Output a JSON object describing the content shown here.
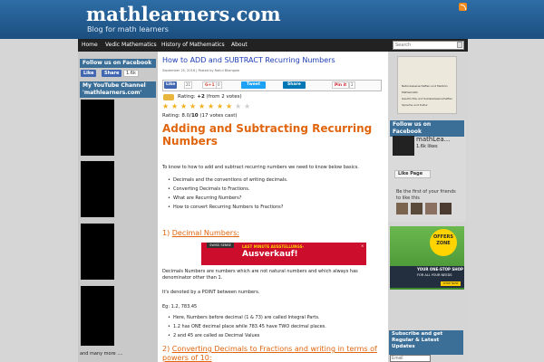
{
  "site": {
    "title": "mathlearners.com",
    "tagline": "Blog for math learners",
    "rss_icon": "rss-icon"
  },
  "nav": {
    "items": [
      "Home",
      "Vedic Mathematics",
      "History of Mathematics",
      "About"
    ],
    "search_placeholder": "Search"
  },
  "left_sidebar": {
    "follow_title": "Follow us on Facebook",
    "like_label": "Like",
    "share_label": "Share",
    "like_count": "1.6k",
    "youtube_title": "My YouTube Channel 'mathlearners.com'",
    "more_label": "and many more ...."
  },
  "post": {
    "title": "How to ADD and SUBTRACT Recurring Numbers",
    "meta": "September 25, 2016 | Posted by Rahul Bhangale",
    "share": {
      "like": "Like",
      "like_count": "21",
      "gplus": "G+1",
      "gplus_count": "0",
      "tweet": "Tweet",
      "linkedin": "Share",
      "pin": "Pin it",
      "pin_count": "2"
    },
    "rating_line": "Rating: +2 (from 2 votes)",
    "rating_prefix": "Rating: ",
    "rating_value": "+2",
    "rating_votes": " (from 2 votes)",
    "stars_filled": 8,
    "stars_total": 10,
    "rating2": "Rating: 8.0/10 (17 votes cast)",
    "rating2_prefix": "Rating: 8.0/",
    "rating2_max": "10",
    "rating2_suffix": " (17 votes cast)",
    "heading": "Adding and Subtracting Recurring Numbers",
    "intro": "To know to how to add and subtract recurring numbers we need to know below basics.",
    "basics": [
      "Decimals and the conventions of writing decimals.",
      "Converting Decimals to Fractions.",
      "What are Recurring Numbers?",
      "How to convert Recurring Numbers to Fractions?"
    ],
    "section1_num": "1)",
    "section1_title": "Decimal Numbers:",
    "ad": {
      "label": "SWISS SENSE",
      "headline": "LAST MINUTE AUSSTELLUNGS-",
      "main": "Ausverkauf!",
      "close": "×"
    },
    "p1": "Decimals Numbers are numbers which are not natural numbers and which always has denominator other than 1.",
    "p2": "It's denoted by a POINT between numbers.",
    "p3": "Eg: 1.2, 783.45",
    "points": [
      "Here, Numbers before decimal (1 & 73) are called Integral Parts.",
      "1.2 has ONE decimal place while 783.45 have TWO decimal places.",
      "2 and 45 are called as Decimal Values"
    ],
    "section2_num": "2)",
    "section2_title": "Converting Decimals to Fractions and writing in terms of powers of 10:"
  },
  "right_sidebar": {
    "ad1_lines": [
      "Naturwissenschaften und Medizin",
      "Mathematik",
      "Geschichte und Sozialwissenschaften",
      "Sprache und Kultur"
    ],
    "fb_title": "Follow us on Facebook",
    "fb_name": "mathLea...",
    "fb_likes": "1.6k likes",
    "like_page": "Like Page",
    "fb_first": "Be the first of your friends to like this",
    "offers": "OFFERS ZONE",
    "onestop": "YOUR ONE-STOP SHOP",
    "onestop_sub": "FOR ALL YOUR NEEDS",
    "shop_now": "SHOP NOW",
    "subscribe": "Subscribe and get Regular & Latest Updates",
    "email_placeholder": "Email"
  }
}
